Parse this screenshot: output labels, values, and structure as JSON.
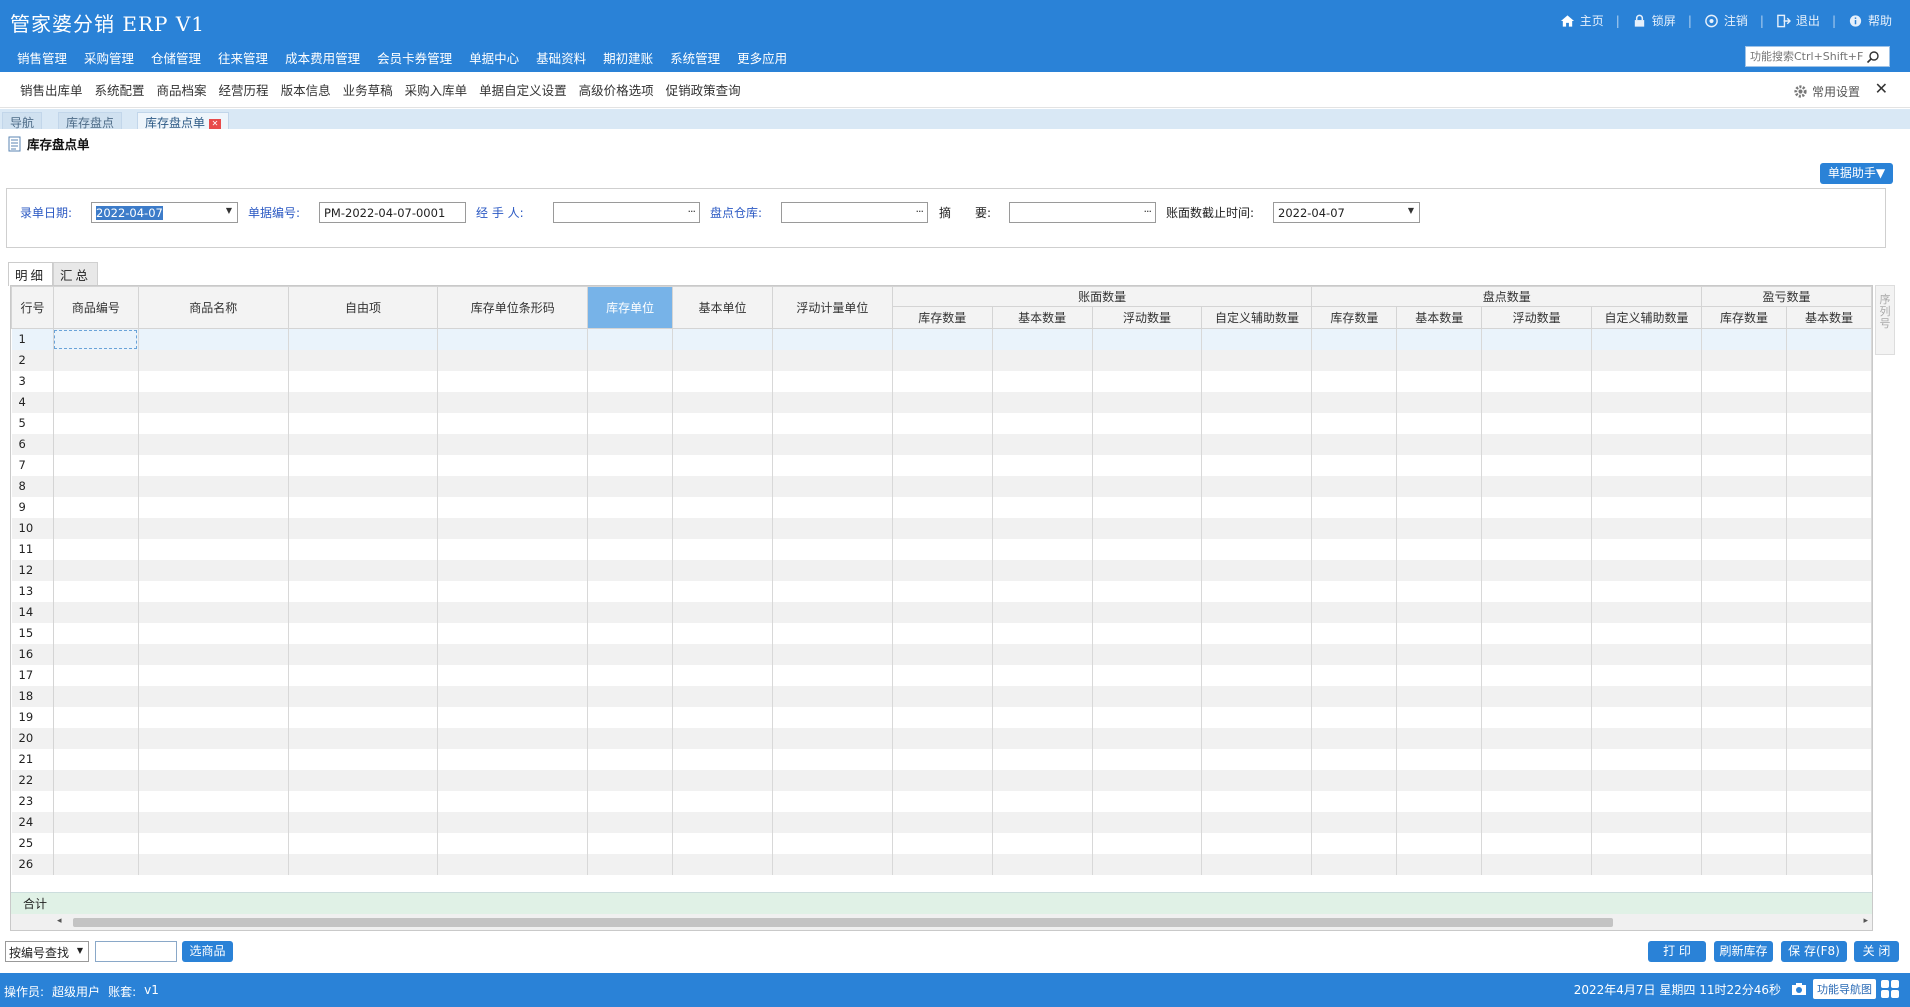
{
  "app": {
    "title": "管家婆分销 ERP V1"
  },
  "top_links": [
    {
      "label": "主页",
      "icon": "home-icon"
    },
    {
      "label": "锁屏",
      "icon": "lock-icon"
    },
    {
      "label": "注销",
      "icon": "logout-icon"
    },
    {
      "label": "退出",
      "icon": "exit-icon"
    },
    {
      "label": "帮助",
      "icon": "help-icon"
    }
  ],
  "menu": [
    "销售管理",
    "采购管理",
    "仓储管理",
    "往来管理",
    "成本费用管理",
    "会员卡券管理",
    "单据中心",
    "基础资料",
    "期初建账",
    "系统管理",
    "更多应用"
  ],
  "function_search": {
    "placeholder": "功能搜索Ctrl+Shift+F"
  },
  "subnav": [
    "销售出库单",
    "系统配置",
    "商品档案",
    "经营历程",
    "版本信息",
    "业务草稿",
    "采购入库单",
    "单据自定义设置",
    "高级价格选项",
    "促销政策查询"
  ],
  "common_settings": "常用设置",
  "close_symbol": "✕",
  "tabs": [
    {
      "label": "导航"
    },
    {
      "label": "库存盘点"
    },
    {
      "label": "库存盘点单",
      "closable": true
    }
  ],
  "page": {
    "title": "库存盘点单",
    "helper_button": "单据助手▼"
  },
  "form": {
    "date_label": "录单日期:",
    "date_value": "2022-04-07",
    "number_label": "单据编号:",
    "number_value": "PM-2022-04-07-0001",
    "handler_label": "经 手 人:",
    "handler_value": "",
    "warehouse_label": "盘点仓库:",
    "warehouse_value": "",
    "summary_label": "摘　　要:",
    "summary_value": "",
    "cutoff_label": "账面数截止时间:",
    "cutoff_value": "2022-04-07",
    "browse_symbol": "···",
    "dropdown_symbol": "▼"
  },
  "detail_tabs": [
    {
      "label": "明细",
      "active": true
    },
    {
      "label": "汇总",
      "active": false
    }
  ],
  "grid": {
    "columns": [
      "行号",
      "商品编号",
      "商品名称",
      "自由项",
      "库存单位条形码",
      "库存单位",
      "基本单位",
      "浮动计量单位"
    ],
    "groups": [
      {
        "label": "账面数量",
        "sub": [
          "库存数量",
          "基本数量",
          "浮动数量",
          "自定义辅助数量"
        ]
      },
      {
        "label": "盘点数量",
        "sub": [
          "库存数量",
          "基本数量",
          "浮动数量",
          "自定义辅助数量"
        ]
      },
      {
        "label": "盈亏数量",
        "sub": [
          "库存数量",
          "基本数量"
        ]
      }
    ],
    "highlighted_column": "库存单位",
    "rows": [
      "1",
      "2",
      "3",
      "4",
      "5",
      "6",
      "7",
      "8",
      "9",
      "10",
      "11",
      "12",
      "13",
      "14",
      "15",
      "16",
      "17",
      "18",
      "19",
      "20",
      "21",
      "22",
      "23",
      "24",
      "25",
      "26"
    ],
    "total_label": "合计"
  },
  "right_strip": "序列号",
  "bottom": {
    "search_mode": "按编号查找",
    "pick_button": "选商品",
    "buttons": [
      "打 印",
      "刷新库存",
      "保 存(F8)",
      "关 闭"
    ]
  },
  "status": {
    "operator_label": "操作员:",
    "operator_value": "超级用户",
    "account_label": "账套:",
    "account_value": "v1",
    "datetime": "2022年4月7日  星期四  11时22分46秒",
    "nav_button": "功能导航图"
  },
  "colors": {
    "primary": "#2a82d7",
    "highlight_col": "#77b3e8",
    "label_blue": "#2b59c3",
    "sum_row": "#e0f1e6"
  }
}
